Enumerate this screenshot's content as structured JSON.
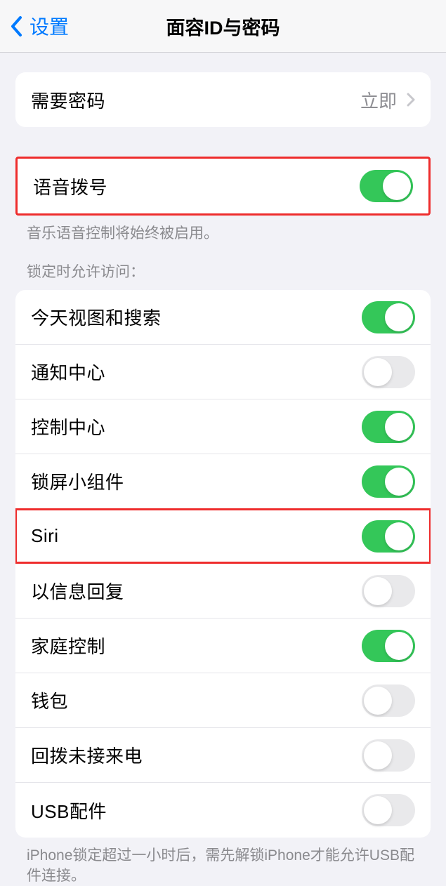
{
  "nav": {
    "back_label": "设置",
    "title": "面容ID与密码"
  },
  "passcode": {
    "require_label": "需要密码",
    "require_value": "立即"
  },
  "voice_dial": {
    "label": "语音拨号",
    "footer": "音乐语音控制将始终被启用。",
    "on": true
  },
  "locked_access": {
    "header": "锁定时允许访问：",
    "items": [
      {
        "label": "今天视图和搜索",
        "on": true
      },
      {
        "label": "通知中心",
        "on": false
      },
      {
        "label": "控制中心",
        "on": true
      },
      {
        "label": "锁屏小组件",
        "on": true
      },
      {
        "label": "Siri",
        "on": true
      },
      {
        "label": "以信息回复",
        "on": false
      },
      {
        "label": "家庭控制",
        "on": true
      },
      {
        "label": "钱包",
        "on": false
      },
      {
        "label": "回拨未接来电",
        "on": false
      },
      {
        "label": "USB配件",
        "on": false
      }
    ],
    "footer": "iPhone锁定超过一小时后，需先解锁iPhone才能允许USB配件连接。"
  }
}
